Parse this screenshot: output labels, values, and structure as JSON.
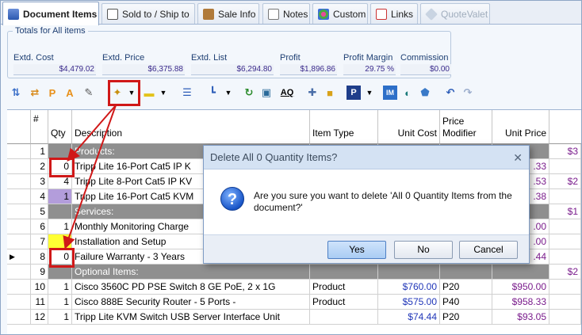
{
  "tabs": [
    {
      "label": "Document Items",
      "icon": "document-items-icon"
    },
    {
      "label": "Sold to / Ship to",
      "icon": "sold-to-icon"
    },
    {
      "label": "Sale Info",
      "icon": "sale-info-icon"
    },
    {
      "label": "Notes",
      "icon": "notes-icon"
    },
    {
      "label": "Custom",
      "icon": "custom-icon"
    },
    {
      "label": "Links",
      "icon": "links-icon"
    },
    {
      "label": "QuoteValet",
      "icon": "quotevalet-icon"
    }
  ],
  "totals": {
    "title": "Totals for All items",
    "fields": [
      {
        "label": "Extd. Cost",
        "value": "$4,479.02"
      },
      {
        "label": "Extd. Price",
        "value": "$6,375.88"
      },
      {
        "label": "Extd. List",
        "value": "$6,294.80"
      },
      {
        "label": "Profit",
        "value": "$1,896.86"
      },
      {
        "label": "Profit Margin",
        "value": "29.75 %"
      },
      {
        "label": "Commission",
        "value": "$0.00"
      }
    ]
  },
  "toolbar": {
    "icons": [
      "move-icon",
      "reorder-icon",
      "p-icon",
      "a-icon",
      "edit-icon",
      "magic-wand-icon",
      "highlighter-icon",
      "lines-icon",
      "hierarchy-icon",
      "refresh-icon",
      "image-icon",
      "aq-icon",
      "puzzle-icon",
      "cube-icon",
      "p-badge-icon",
      "im-icon",
      "circle-icon",
      "shield-icon",
      "undo-icon",
      "redo-icon"
    ],
    "aq_label": "AQ",
    "p_label": "P",
    "a_label": "A",
    "im_label": "IM"
  },
  "grid": {
    "headers": {
      "hash": "#",
      "qty": "Qty",
      "description": "Description",
      "item_type": "Item Type",
      "unit_cost": "Unit Cost",
      "price_modifier": "Price Modifier",
      "unit_price": "Unit Price"
    },
    "rows": [
      {
        "num": "1",
        "qty": "",
        "desc": "Products:",
        "type": "",
        "cost": "",
        "mod": "",
        "price": "",
        "extra": "$3",
        "section": true
      },
      {
        "num": "2",
        "qty": "0",
        "desc": "Tripp Lite 16-Port Cat5 IP K",
        "type": "",
        "cost": "",
        "mod": "",
        "price": ".33",
        "extra": ""
      },
      {
        "num": "3",
        "qty": "4",
        "desc": "Tripp Lite 8-Port Cat5 IP KV",
        "type": "",
        "cost": "",
        "mod": "",
        "price": ".53",
        "extra": "$2"
      },
      {
        "num": "4",
        "qty": "1",
        "desc": "Tripp Lite 16-Port Cat5 KVM",
        "type": "",
        "cost": "",
        "mod": "",
        "price": ".38",
        "extra": ""
      },
      {
        "num": "5",
        "qty": "",
        "desc": "Services:",
        "type": "",
        "cost": "",
        "mod": "",
        "price": "",
        "extra": "$1",
        "section": true
      },
      {
        "num": "6",
        "qty": "1",
        "desc": "Monthly Monitoring Charge",
        "type": "",
        "cost": "",
        "mod": "",
        "price": ".00",
        "extra": ""
      },
      {
        "num": "7",
        "qty": "2",
        "desc": "Installation and Setup",
        "type": "",
        "cost": "",
        "mod": "",
        "price": ".00",
        "extra": ""
      },
      {
        "num": "8",
        "qty": "0",
        "desc": "Failure Warranty - 3 Years",
        "type": "",
        "cost": "",
        "mod": "",
        "price": ".44",
        "extra": ""
      },
      {
        "num": "9",
        "qty": "",
        "desc": "Optional Items:",
        "type": "",
        "cost": "",
        "mod": "",
        "price": "",
        "extra": "$2",
        "section": true
      },
      {
        "num": "10",
        "qty": "1",
        "desc": "Cisco 3560C PD PSE Switch 8 GE PoE, 2 x 1G",
        "type": "Product",
        "cost": "$760.00",
        "mod": "P20",
        "price": "$950.00",
        "extra": ""
      },
      {
        "num": "11",
        "qty": "1",
        "desc": "Cisco 888E Security Router - 5 Ports -",
        "type": "Product",
        "cost": "$575.00",
        "mod": "P40",
        "price": "$958.33",
        "extra": ""
      },
      {
        "num": "12",
        "qty": "1",
        "desc": "Tripp Lite KVM Switch USB Server Interface Unit",
        "type": "",
        "cost": "$74.44",
        "mod": "P20",
        "price": "$93.05",
        "extra": ""
      }
    ]
  },
  "dialog": {
    "title": "Delete All 0 Quantity Items?",
    "close": "✕",
    "icon_text": "?",
    "message": "Are you sure you want to delete 'All 0 Quantity Items from the document?'",
    "yes": "Yes",
    "no": "No",
    "cancel": "Cancel"
  },
  "colors": {
    "accent": "#d01818",
    "section_bg": "#8f8f8f",
    "price_blue": "#2036b8",
    "price_purple": "#7a1c8c"
  }
}
